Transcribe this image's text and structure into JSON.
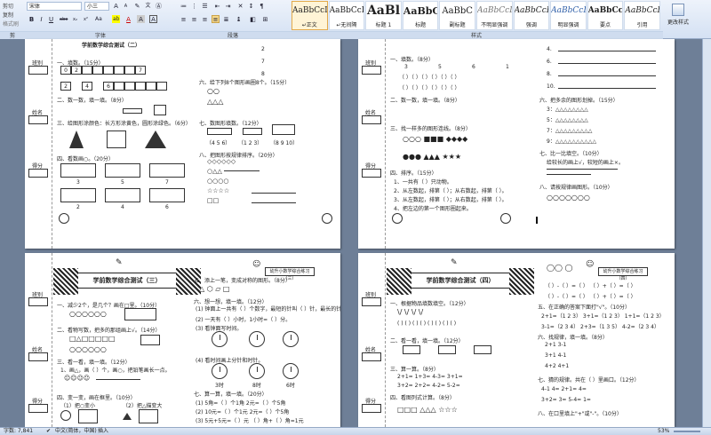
{
  "ribbon": {
    "groups": {
      "clipboard": "剪",
      "font": "字体",
      "paragraph": "段落",
      "styles": "样式"
    },
    "clipboard": {
      "cut": "剪切",
      "copy": "复制",
      "format_painter": "格式刷"
    },
    "font": {
      "font_name": "宋体",
      "font_size": "小三",
      "bold": "B",
      "italic": "I",
      "underline": "U",
      "strike": "abe",
      "sub": "x₂",
      "sup": "x²",
      "case": "Aa",
      "highlight": "ab",
      "color": "A",
      "grow": "A",
      "shrink": "A"
    },
    "styles": [
      {
        "preview": "AaBbCcDd",
        "name": "↵正文",
        "selected": true,
        "big": false
      },
      {
        "preview": "AaBbCcDd",
        "name": "↵无间隔",
        "selected": false,
        "big": false
      },
      {
        "preview": "AaBl",
        "name": "标题 1",
        "selected": false,
        "big": true
      },
      {
        "preview": "AaBbC",
        "name": "标题",
        "selected": false,
        "big": true
      },
      {
        "preview": "AaBbC",
        "name": "副标题",
        "selected": false,
        "big": false
      },
      {
        "preview": "AaBbCcDd",
        "name": "不明显强调",
        "selected": false,
        "big": false
      },
      {
        "preview": "AaBbCcDd",
        "name": "强调",
        "selected": false,
        "big": false
      },
      {
        "preview": "AaBbCcDd",
        "name": "明显强调",
        "selected": false,
        "big": false
      },
      {
        "preview": "AaBbCcDd",
        "name": "要点",
        "selected": false,
        "big": false
      },
      {
        "preview": "AaBbCcDd",
        "name": "引用",
        "selected": false,
        "big": false
      },
      {
        "preview": "AaBbCcDd",
        "name": "明显引用",
        "selected": false,
        "big": false
      }
    ],
    "change_styles": "更改样式"
  },
  "status": {
    "words": "字数: 7,841",
    "language": "中文(简体，中国)",
    "insert_mode": "插入",
    "zoom": "53%"
  },
  "pages": {
    "p1": {
      "side_labels": [
        "班别",
        "姓名",
        "得分"
      ],
      "title": "学前数学综合测试（二）",
      "q1": "一、填数。（15分）",
      "row1": [
        "0",
        "2",
        "",
        "",
        "",
        "",
        "",
        "7"
      ],
      "row2": [
        "2",
        "4",
        "6",
        "",
        "",
        "",
        "",
        ""
      ],
      "q2": "二、数一数，填一填。（8分）",
      "q3": "三、给图形涂颜色：长方形涂黄色，圆形涂绿色。（6分）",
      "q4": "四、看数画○。（20分）",
      "q4_nums": [
        "3",
        "5",
        "7",
        "2",
        "4",
        "6"
      ],
      "q5": "五、",
      "q6": "六、给下列8个图形画圈8个。（15分）",
      "q7": "七、数图形填数。（12分）",
      "q7_labels": [
        "（4 5 6）",
        "（1 2 3）",
        "（8 9 10）"
      ],
      "q8": "八、把图形按规律排序。（20分）",
      "right_nums": [
        "2",
        "7",
        "8"
      ]
    },
    "p2": {
      "side_labels": [
        "班别",
        "姓名",
        "得分"
      ],
      "q1": "一、填数。（8分）",
      "row_nums": [
        "3",
        "5",
        "6",
        "1"
      ],
      "q2": "二、数一数，填一填。（8分）",
      "q3": "三、找一样多的图形连线。（8分）",
      "q4": "四、排序。（15分）",
      "q4_lines": [
        "1、一共有（   ）只动物。",
        "2、从左数起，排第（   ）；从右数起，排第（   ）。",
        "3、从左数起，排第（   ）；从右数起，排第（   ）。",
        "4、把左边的第一个图形圈起来。"
      ],
      "right_nums": [
        "4.",
        "6.",
        "8.",
        "10."
      ],
      "q6": "六、把多余的图形划掉。（15分）",
      "q6_lines": [
        "3：△△△△△△△△",
        "5：△△△△△△△△",
        "7：△△△△△△△△△",
        "9：△△△△△△△△△△"
      ],
      "q7": "七、比一比填空。（10分）",
      "q7_line": "给较长的画上√，较短的画上×。",
      "q8": "八、请按规律画图形。（10分）",
      "q8_line": "○○○○○○○"
    },
    "p3": {
      "side_labels": [
        "班别",
        "姓名",
        "得分"
      ],
      "title": "学前数学综合测试（三）",
      "badge": "幼升小数学综合练习（三）",
      "q1": "一、减少2个，是几个？画在□里。（10分）",
      "q2": "二、看物写数，把多的那组画上√。（14分）",
      "q3": "三、看一看，填一填。（12分）",
      "q3_lines": [
        "1、画△，画（ ）个，画○，把铅笔画长一点。",
        "2、"
      ],
      "q4": "四、变一变，画在框里。（10分）",
      "q4_lines": [
        "（1）把○变小",
        "（2）把△描变大"
      ],
      "r1": "五、添上一笔，变成对称的图形。（8分）",
      "r2": "六、想一想，填一填。（12分）",
      "r2_lines": [
        "(1) 钟面上一共有（  ）个数字，最短的针叫（  ）针，最长的针叫（  ）针。",
        "(2) 一天有（  ）小时，1小时=（  ）分。",
        "(3) 看钟面写时间。"
      ],
      "r3": "七、算一算，填一填。（20分）",
      "r3_lines": [
        "(1) 5角=（  ）个1角   2元=（  ）个5角",
        "(2) 10元=（  ）个1元    2元=（  ）个5角",
        "(3) 5元+5元=（  ）元   （  ）角+（  ）角=1元"
      ],
      "clock_labels": [
        "3时",
        "8时",
        "6时"
      ]
    },
    "p4": {
      "side_labels": [
        "班别",
        "姓名",
        "得分"
      ],
      "title": "学前数学综合测试（四）",
      "badge": "幼升小数学综合练习（四）",
      "q1": "一、根据物品填数填空。（12分）",
      "q2": "二、看一看，填一填。（12分）",
      "q3": "三、算一算。（8分）",
      "q3_rows": [
        "2+1=   1+3=   4-3=   3+1=",
        "3+2=   2+2=   4-2=   5-2="
      ],
      "q4": "四、看图列式计算。（8分）",
      "r_rows": [
        "（ ）-（ ）=（ ）   （ ）+（ ）=（ ）",
        "（ ）-（ ）=（ ）   （ ）+（ ）=（ ）"
      ],
      "q5": "五、在正确的答案下面打\"√\"。（10分）",
      "q5_rows": [
        "2+1=（1 2 3）   3+1=（1 2 3）   1+1=（1 2 3）",
        "3-1=（2 3 4）   2+3=（1 3 5）   4-2=（2 3 4）"
      ],
      "q6": "六、找规律，填一填。（8分）",
      "q6_rows": [
        "2+1          3-1",
        "3+1          4-1",
        "4+2          4+1"
      ],
      "q7": "七、猜的规律。共在（  ）里画口。（12分）",
      "q7_rows": [
        "4-1     4=     2+1=     4=",
        "3+2=     3=     5-4=     1="
      ],
      "q8": "八、在口里填上\"+\"或\"-\"。（10分）"
    }
  }
}
